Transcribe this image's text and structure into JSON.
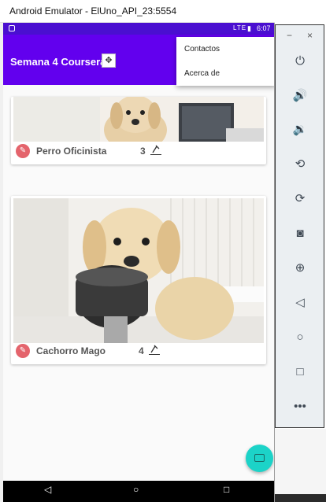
{
  "window": {
    "title": "Android Emulator - ElUno_API_23:5554"
  },
  "status_bar": {
    "network": "LTE",
    "time": "6:07"
  },
  "app_bar": {
    "title": "Semana 4 Coursera"
  },
  "overflow_menu": {
    "items": [
      "Contactos",
      "Acerca de"
    ]
  },
  "pets": [
    {
      "name": "Perro Oficinista",
      "likes": "3"
    },
    {
      "name": "Cachorro Mago",
      "likes": "4"
    }
  ],
  "emulator_controls": {
    "minimize": "−",
    "close": "×",
    "buttons": [
      "power-icon",
      "volume-up-icon",
      "volume-down-icon",
      "rotate-left-icon",
      "rotate-right-icon",
      "camera-icon",
      "zoom-icon",
      "back-icon",
      "home-icon",
      "overview-icon",
      "more-icon"
    ]
  },
  "colors": {
    "primary": "#6200ee",
    "status_bar": "#4a0fd0",
    "fab": "#1cd3c8",
    "bone": "#e4646c"
  }
}
